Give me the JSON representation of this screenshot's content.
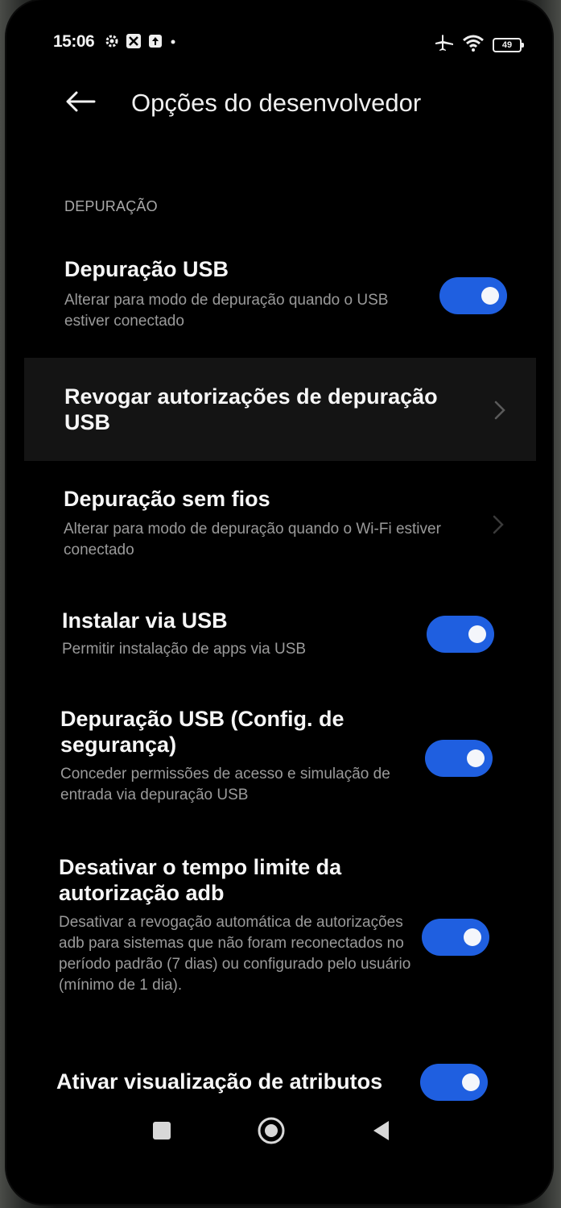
{
  "status_bar": {
    "time": "15:06",
    "battery_level": "49",
    "left_icons": [
      "gear-icon",
      "app-notification-icon",
      "upload-icon",
      "dot-icon"
    ],
    "right_icons": [
      "airplane-icon",
      "wifi-icon",
      "battery-icon"
    ]
  },
  "header": {
    "title": "Opções do desenvolvedor"
  },
  "section": {
    "header": "DEPURAÇÃO"
  },
  "settings": [
    {
      "title": "Depuração USB",
      "description": "Alterar para modo de depuração quando o USB estiver conectado",
      "control": "toggle",
      "enabled": true
    },
    {
      "title": "Revogar autorizações de depuração USB",
      "control": "chevron"
    },
    {
      "title": "Depuração sem fios",
      "description": "Alterar para modo de depuração quando o Wi-Fi estiver conectado",
      "control": "chevron"
    },
    {
      "title": "Instalar via USB",
      "description": "Permitir instalação de apps via USB",
      "control": "toggle",
      "enabled": true
    },
    {
      "title": "Depuração USB (Config. de segurança)",
      "description": "Conceder permissões de acesso e simulação de entrada via depuração USB",
      "control": "toggle",
      "enabled": true
    },
    {
      "title": "Desativar o tempo limite da autorização adb",
      "description": "Desativar a revogação automática de autorizações adb para sistemas que não foram reconectados no período padrão (7 dias) ou configurado pelo usuário (mínimo de 1 dia).",
      "control": "toggle",
      "enabled": true
    },
    {
      "title": "Ativar visualização de atributos",
      "control": "toggle",
      "enabled": true
    }
  ],
  "colors": {
    "background": "#000000",
    "toggle_on": "#1f5fe0",
    "title_text": "#f6f6f6",
    "description_text": "#9a9a9a"
  },
  "nav_bar": {
    "icons": [
      "recent-apps-icon",
      "home-icon",
      "back-nav-icon"
    ]
  }
}
